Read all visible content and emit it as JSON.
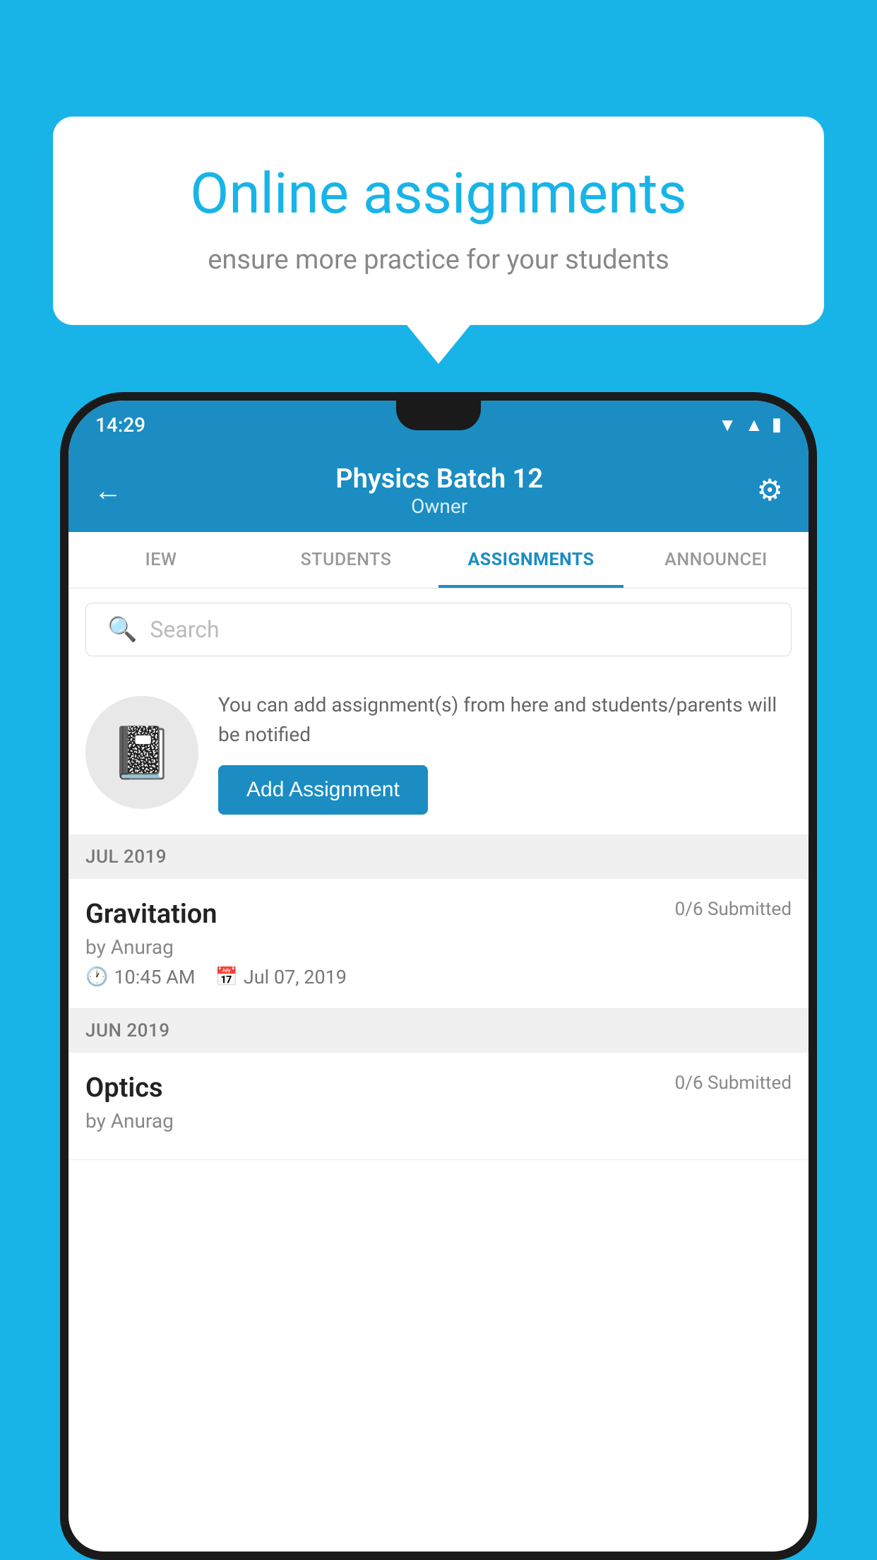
{
  "background_color": "#18B4E8",
  "speech_bubble": {
    "title": "Online assignments",
    "subtitle": "ensure more practice for your students"
  },
  "phone": {
    "status_bar": {
      "time": "14:29",
      "icons": [
        "wifi",
        "signal",
        "battery"
      ]
    },
    "header": {
      "title": "Physics Batch 12",
      "subtitle": "Owner",
      "back_label": "←",
      "settings_label": "⚙"
    },
    "tabs": [
      {
        "label": "IEW",
        "active": false
      },
      {
        "label": "STUDENTS",
        "active": false
      },
      {
        "label": "ASSIGNMENTS",
        "active": true
      },
      {
        "label": "ANNOUNCEI",
        "active": false
      }
    ],
    "search": {
      "placeholder": "Search"
    },
    "add_assignment_card": {
      "description": "You can add assignment(s) from here and students/parents will be notified",
      "button_label": "Add Assignment"
    },
    "sections": [
      {
        "month": "JUL 2019",
        "assignments": [
          {
            "name": "Gravitation",
            "submitted": "0/6 Submitted",
            "author": "by Anurag",
            "time": "10:45 AM",
            "date": "Jul 07, 2019"
          }
        ]
      },
      {
        "month": "JUN 2019",
        "assignments": [
          {
            "name": "Optics",
            "submitted": "0/6 Submitted",
            "author": "by Anurag",
            "time": "",
            "date": ""
          }
        ]
      }
    ]
  }
}
